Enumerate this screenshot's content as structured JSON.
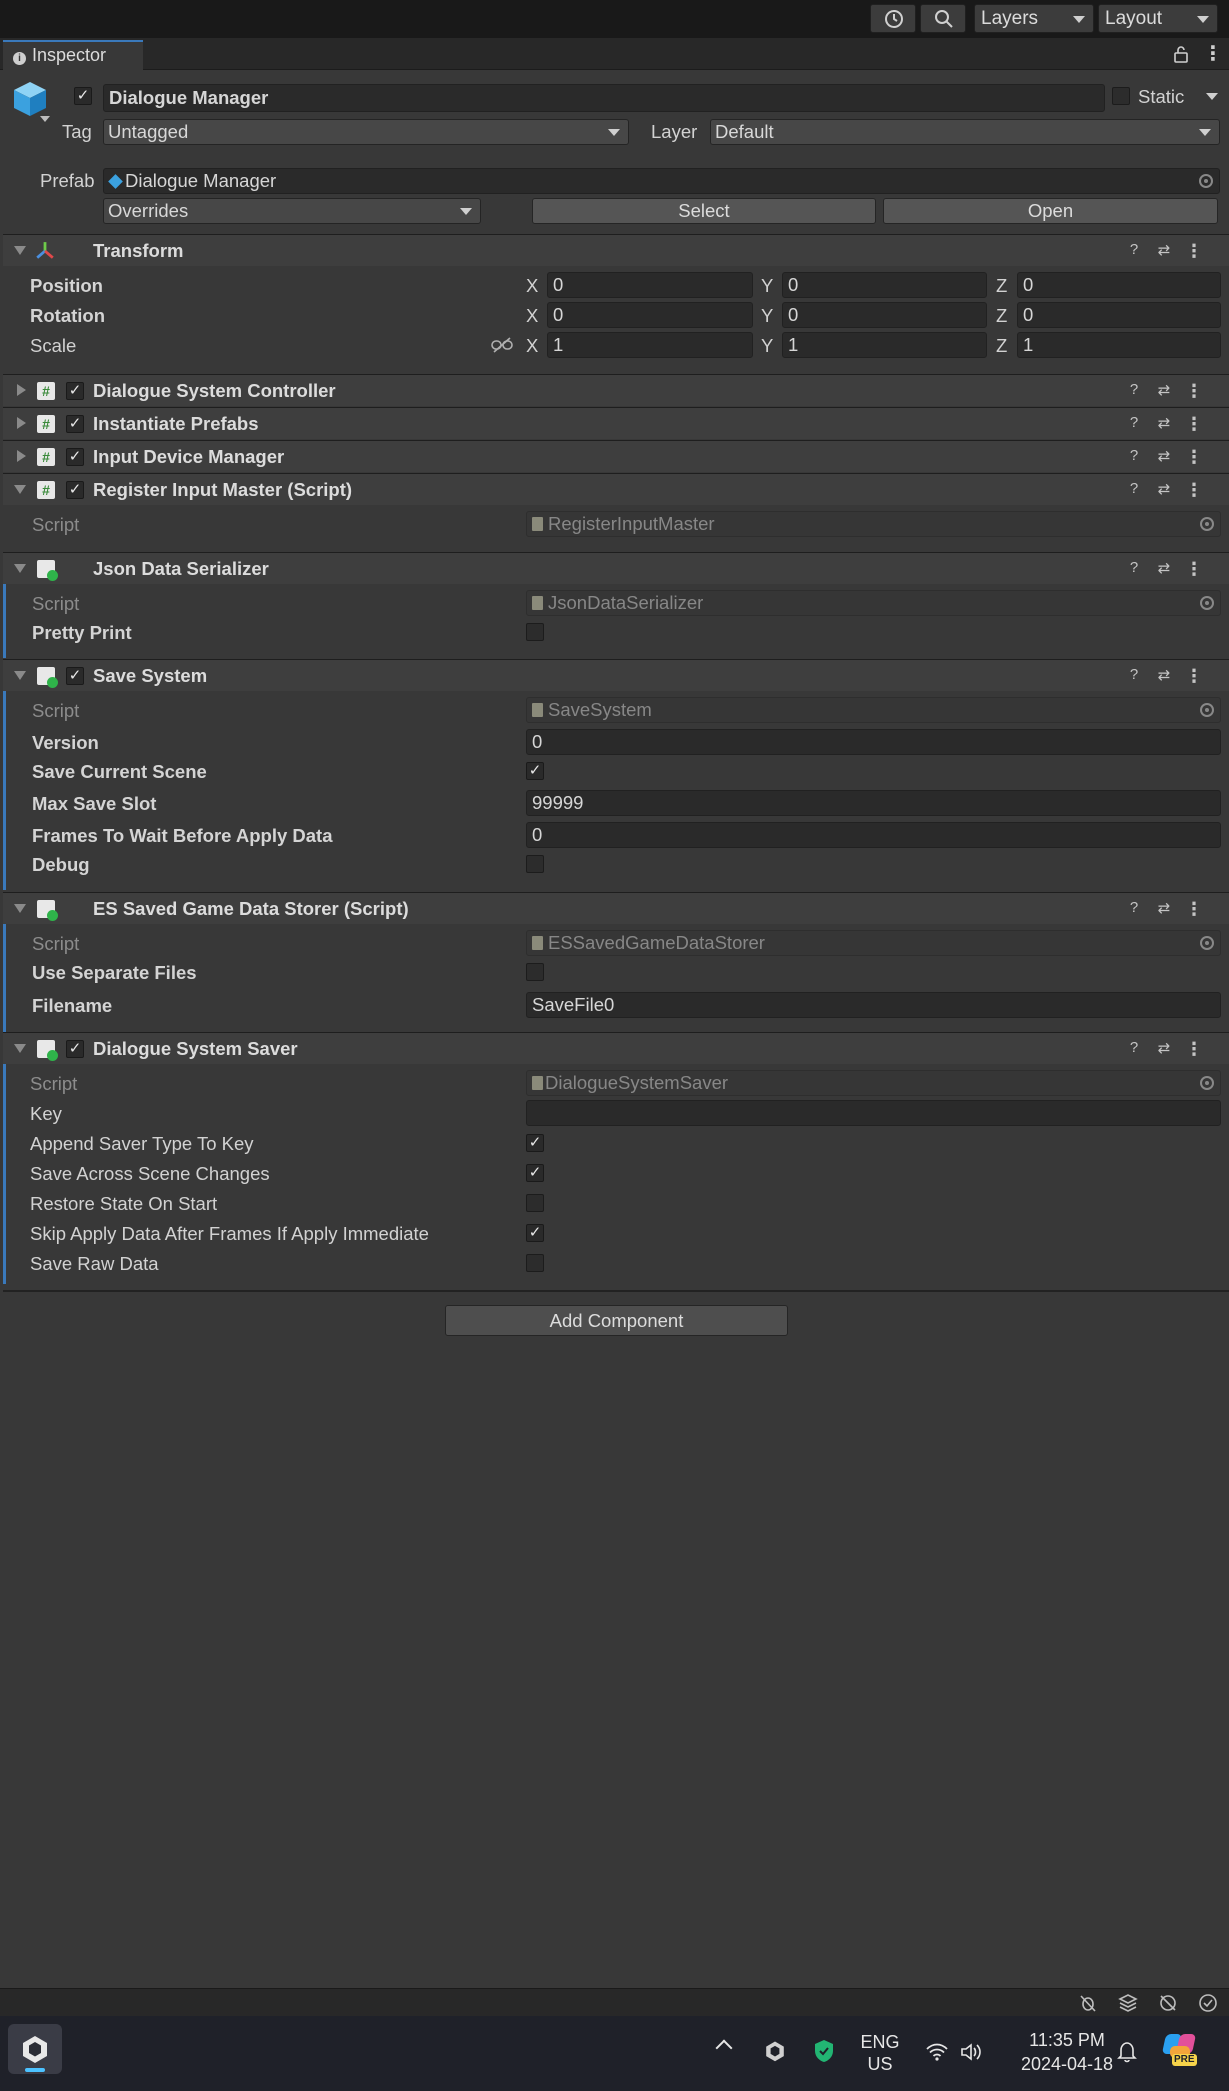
{
  "topbar": {
    "history_icon": "history-icon",
    "search_icon": "search-icon",
    "layers_label": "Layers",
    "layout_label": "Layout"
  },
  "tab": {
    "label": "Inspector",
    "info_icon": "info-icon"
  },
  "object": {
    "active": true,
    "name": "Dialogue Manager",
    "static_label": "Static",
    "static_checked": false,
    "tag_label": "Tag",
    "tag_value": "Untagged",
    "layer_label": "Layer",
    "layer_value": "Default",
    "prefab_label": "Prefab",
    "prefab_value": "Dialogue Manager",
    "overrides_label": "Overrides",
    "select_label": "Select",
    "open_label": "Open"
  },
  "transform": {
    "title": "Transform",
    "position_label": "Position",
    "rotation_label": "Rotation",
    "scale_label": "Scale",
    "x": "X",
    "y": "Y",
    "z": "Z",
    "position": [
      "0",
      "0",
      "0"
    ],
    "rotation": [
      "0",
      "0",
      "0"
    ],
    "scale": [
      "1",
      "1",
      "1"
    ]
  },
  "collapsed_components": [
    {
      "title": "Dialogue System Controller",
      "enabled": true
    },
    {
      "title": "Instantiate Prefabs",
      "enabled": true
    },
    {
      "title": "Input Device Manager",
      "enabled": true
    }
  ],
  "register_input": {
    "title": "Register Input Master (Script)",
    "script_label": "Script",
    "script_value": "RegisterInputMaster"
  },
  "json_serializer": {
    "title": "Json Data Serializer",
    "script_label": "Script",
    "script_value": "JsonDataSerializer",
    "pretty_print_label": "Pretty Print",
    "pretty_print": false
  },
  "save_system": {
    "title": "Save System",
    "script_label": "Script",
    "script_value": "SaveSystem",
    "version_label": "Version",
    "version": "0",
    "save_current_scene_label": "Save Current Scene",
    "save_current_scene": true,
    "max_save_slot_label": "Max Save Slot",
    "max_save_slot": "99999",
    "frames_label": "Frames To Wait Before Apply Data",
    "frames": "0",
    "debug_label": "Debug",
    "debug": false
  },
  "es_storer": {
    "title": "ES Saved Game Data Storer (Script)",
    "script_label": "Script",
    "script_value": "ESSavedGameDataStorer",
    "use_separate_label": "Use Separate Files",
    "use_separate": false,
    "filename_label": "Filename",
    "filename": "SaveFile0"
  },
  "dialogue_saver": {
    "title": "Dialogue System Saver",
    "script_label": "Script",
    "script_value": "DialogueSystemSaver",
    "key_label": "Key",
    "key": "",
    "append_label": "Append Saver Type To Key",
    "append": true,
    "save_across_label": "Save Across Scene Changes",
    "save_across": true,
    "restore_label": "Restore State On Start",
    "restore": false,
    "skip_label": "Skip Apply Data After Frames If Apply Immediate",
    "skip": true,
    "raw_label": "Save Raw Data",
    "raw": false
  },
  "add_component_label": "Add Component",
  "status_icons": [
    "bug-off-icon",
    "stack-icon",
    "network-off-icon",
    "check-circle-icon"
  ],
  "taskbar": {
    "app_icon": "unity-icon",
    "chevron_icon": "chevron-up-icon",
    "tray_icons": [
      "unity-hub-icon",
      "shield-icon"
    ],
    "lang_line1": "ENG",
    "lang_line2": "US",
    "wifi_icon": "wifi-icon",
    "volume_icon": "volume-icon",
    "time": "11:35 PM",
    "date": "2024-04-18",
    "bell_icon": "bell-icon",
    "copilot_badge": "PRE"
  },
  "colors": {
    "accent": "#3a79bb",
    "bg": "#383838",
    "header": "#3e3e3e"
  }
}
